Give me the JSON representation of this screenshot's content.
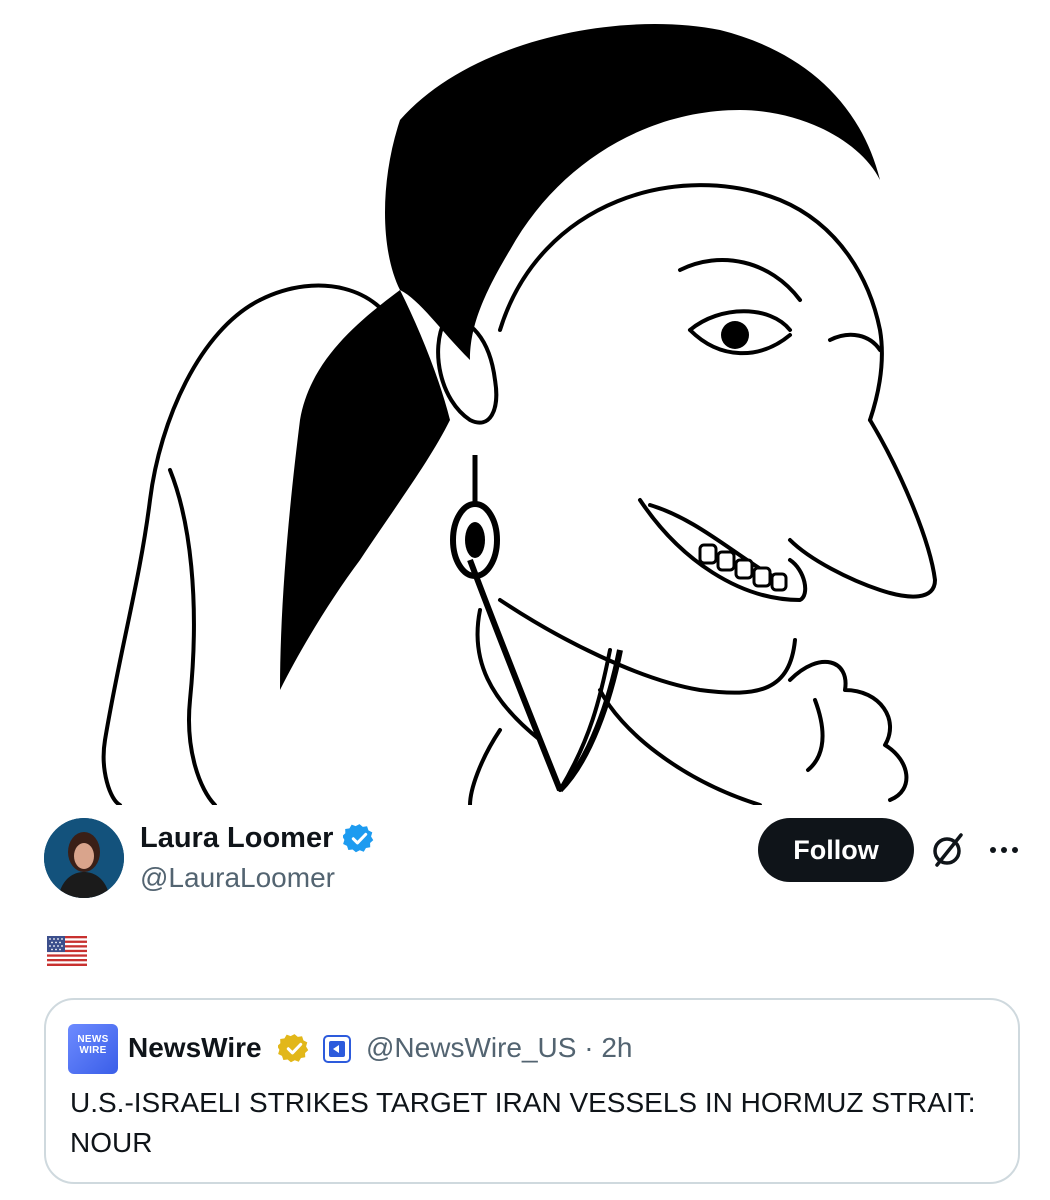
{
  "post": {
    "author_name": "Laura Loomer",
    "author_handle": "@LauraLoomer",
    "follow_label": "Follow",
    "body_text": "🇺🇸"
  },
  "quoted_post": {
    "author_name": "NewsWire",
    "author_handle": "@NewsWire_US",
    "separator": "·",
    "timestamp": "2h",
    "avatar_text_line1": "NEWS",
    "avatar_text_line2": "WIRE",
    "text": "U.S.-ISRAELI STRIKES TARGET IRAN VESSELS IN HORMUZ STRAIT: NOUR"
  },
  "icons": {
    "verified": "verified-badge-icon",
    "grok": "grok-icon",
    "more": "more-options-icon",
    "gold_verified": "gold-verified-badge-icon",
    "affiliate": "affiliate-badge-icon",
    "flag": "us-flag-icon"
  },
  "colors": {
    "primary_text": "#0f1419",
    "secondary_text": "#536471",
    "verified_blue": "#1d9bf0",
    "gold": "#e2b719",
    "border": "#cfd9de",
    "follow_bg": "#0f1419"
  }
}
